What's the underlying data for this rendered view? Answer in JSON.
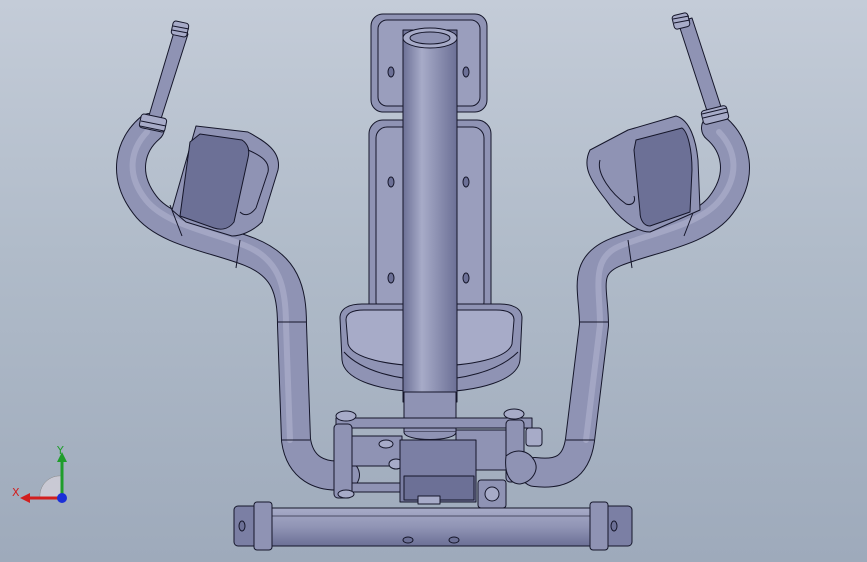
{
  "viewport": {
    "background_top": "#c4ccd8",
    "background_bottom": "#9eaabb"
  },
  "model": {
    "part_fill": "#8f93b4",
    "part_fill_light": "#a7abc8",
    "part_fill_dark": "#6c7096",
    "edge_color": "#15162a"
  },
  "triad": {
    "x_label": "X",
    "y_label": "Y",
    "x_color": "#d21e1e",
    "y_color": "#1f9d2b",
    "z_color": "#1b2fd8"
  }
}
